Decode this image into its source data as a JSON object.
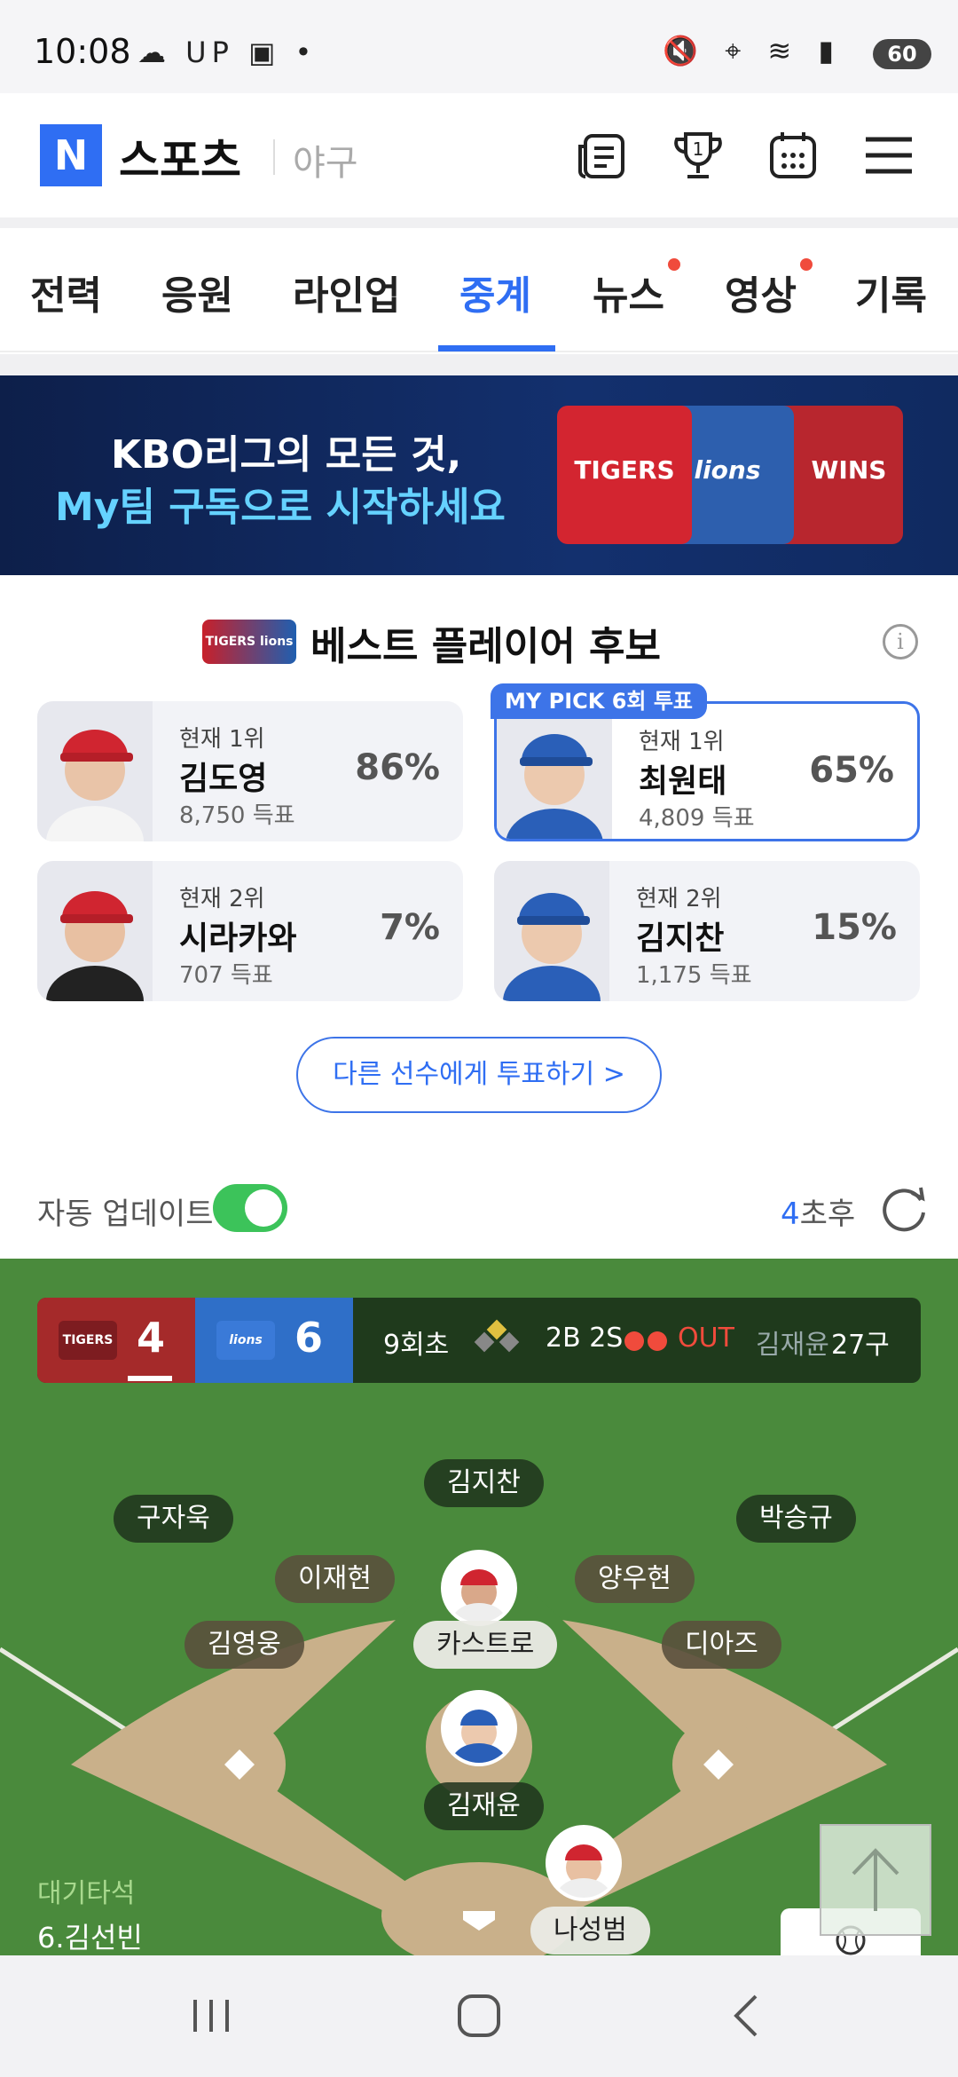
{
  "status": {
    "time": "10:08",
    "battery": "60"
  },
  "header": {
    "logo": "N",
    "title": "스포츠",
    "subtitle": "야구",
    "icons": [
      "news-icon",
      "trophy-icon",
      "calendar-icon",
      "menu-icon"
    ],
    "trophy_badge": "1"
  },
  "tabs": [
    {
      "label": "전력",
      "active": false,
      "dot": false
    },
    {
      "label": "응원",
      "active": false,
      "dot": false
    },
    {
      "label": "라인업",
      "active": false,
      "dot": false
    },
    {
      "label": "중계",
      "active": true,
      "dot": false
    },
    {
      "label": "뉴스",
      "active": false,
      "dot": true
    },
    {
      "label": "영상",
      "active": false,
      "dot": true
    },
    {
      "label": "기록",
      "active": false,
      "dot": false
    }
  ],
  "banner": {
    "line1": "KBO리그의 모든 것,",
    "line2": "My팀 구독으로 시작하세요",
    "logos": [
      "TIGERS",
      "lions",
      "WINS"
    ]
  },
  "best_player": {
    "title": "베스트 플레이어 후보",
    "pick_badge": "MY PICK 6회 투표",
    "candidates": [
      {
        "rank": "현재 1위",
        "name": "김도영",
        "votes": "8,750 득표",
        "percent": "86%",
        "team": "tigers"
      },
      {
        "rank": "현재 1위",
        "name": "최원태",
        "votes": "4,809 득표",
        "percent": "65%",
        "team": "lions",
        "my_pick": true
      },
      {
        "rank": "현재 2위",
        "name": "시라카와",
        "votes": "707 득표",
        "percent": "7%",
        "team": "tigers"
      },
      {
        "rank": "현재 2위",
        "name": "김지찬",
        "votes": "1,175 득표",
        "percent": "15%",
        "team": "lions"
      }
    ],
    "vote_button": "다른 선수에게 투표하기 >"
  },
  "auto_update": {
    "label": "자동 업데이트",
    "enabled": true,
    "countdown_num": "4",
    "countdown_suffix": "초후"
  },
  "game": {
    "away_score": "4",
    "home_score": "6",
    "inning": "9회초",
    "count": "2B 2S",
    "out_label": "OUT",
    "pitcher": "김재윤",
    "pitch_count": "27구",
    "fielders": {
      "cf": "김지찬",
      "lf": "구자욱",
      "rf": "박승규",
      "ss": "이재현",
      "sb": "양우현",
      "tb": "김영웅",
      "fb": "디아즈",
      "runner2": "카스트로",
      "pitcher": "김재윤",
      "batter": "나성범"
    },
    "ondeck_label": "대기타석",
    "ondeck_name": "6.김선빈"
  },
  "colors": {
    "accent": "#2f6ef3",
    "tigers": "#a52a2a",
    "lions": "#2f6fc8",
    "field": "#4a8a3c",
    "dirt": "#c9b08a"
  }
}
